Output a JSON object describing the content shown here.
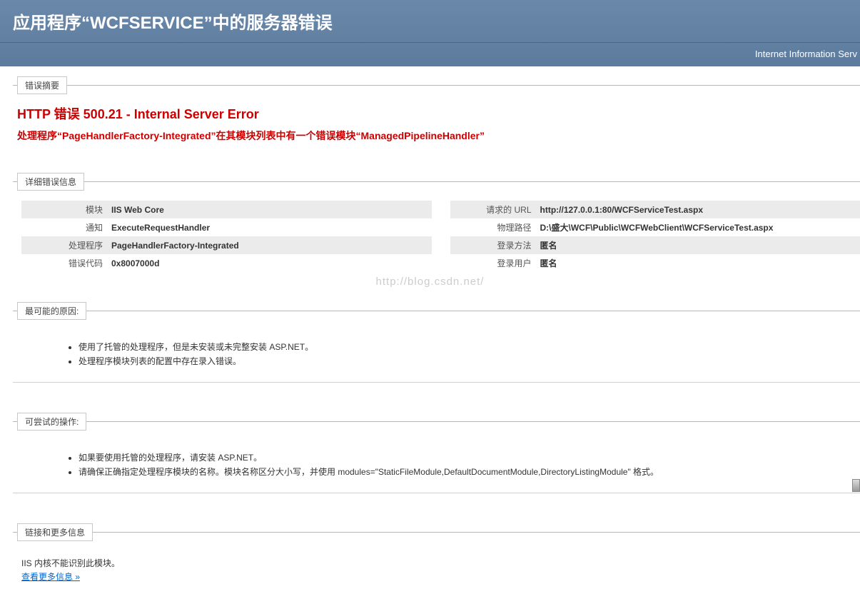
{
  "header": {
    "title": "应用程序“WCFSERVICE”中的服务器错误",
    "subbar": "Internet Information Serv"
  },
  "summary": {
    "legend": "错误摘要",
    "title": "HTTP 错误 500.21 - Internal Server Error",
    "subtitle": "处理程序“PageHandlerFactory-Integrated”在其模块列表中有一个错误模块“ManagedPipelineHandler”"
  },
  "details": {
    "legend": "详细错误信息",
    "left": [
      {
        "label": "模块",
        "value": "IIS Web Core"
      },
      {
        "label": "通知",
        "value": "ExecuteRequestHandler"
      },
      {
        "label": "处理程序",
        "value": "PageHandlerFactory-Integrated"
      },
      {
        "label": "错误代码",
        "value": "0x8007000d"
      }
    ],
    "right": [
      {
        "label": "请求的 URL",
        "value": "http://127.0.0.1:80/WCFServiceTest.aspx"
      },
      {
        "label": "物理路径",
        "value": "D:\\盛大\\WCF\\Public\\WCFWebClient\\WCFServiceTest.aspx"
      },
      {
        "label": "登录方法",
        "value": "匿名"
      },
      {
        "label": "登录用户",
        "value": "匿名"
      }
    ]
  },
  "causes": {
    "legend": "最可能的原因:",
    "items": [
      "使用了托管的处理程序，但是未安装或未完整安装 ASP.NET。",
      "处理程序模块列表的配置中存在录入错误。"
    ]
  },
  "actions": {
    "legend": "可尝试的操作:",
    "items": [
      "如果要使用托管的处理程序，请安装 ASP.NET。",
      "请确保正确指定处理程序模块的名称。模块名称区分大小写，并使用 modules=\"StaticFileModule,DefaultDocumentModule,DirectoryListingModule\" 格式。"
    ]
  },
  "links": {
    "legend": "链接和更多信息",
    "text": "IIS 内核不能识别此模块。",
    "more": "查看更多信息  »"
  },
  "watermark": "http://blog.csdn.net/"
}
